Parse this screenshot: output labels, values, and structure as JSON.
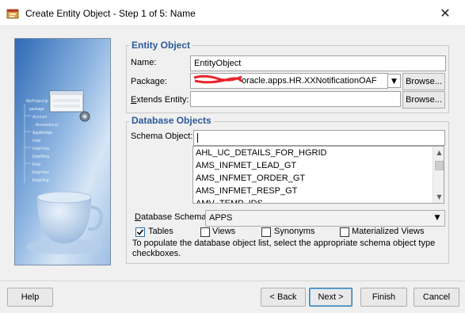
{
  "window": {
    "title": "Create Entity Object - Step 1 of 5: Name",
    "close_glyph": "✕",
    "icon": "entity-wizard-icon"
  },
  "entity_object": {
    "group_title": "Entity Object",
    "name_label": "Name:",
    "name_value": "EntityObject",
    "package_label": "Package:",
    "package_value": "oracle.apps.HR.XXNotificationOAF",
    "package_redacted_prefix_color": "#e8242a",
    "extends_label": "Extends Entity:",
    "extends_value": "",
    "browse_label": "Browse..."
  },
  "database_objects": {
    "group_title": "Database Objects",
    "schema_object_label": "Schema Object:",
    "schema_object_value": "",
    "list_items": [
      "AHL_UC_DETAILS_FOR_HGRID",
      "AMS_INFMET_LEAD_GT",
      "AMS_INFMET_ORDER_GT",
      "AMS_INFMET_RESP_GT",
      "AMV_TEMP_IDS"
    ],
    "database_schema_label": "Database Schema:",
    "database_schema_value": "APPS",
    "checkboxes": [
      {
        "label": "Tables",
        "checked": true
      },
      {
        "label": "Views",
        "checked": false
      },
      {
        "label": "Synonyms",
        "checked": false
      },
      {
        "label": "Materialized Views",
        "checked": false
      }
    ],
    "hint": "To populate the database object list, select the appropriate schema object type checkboxes."
  },
  "footer": {
    "help": "Help",
    "back": "< Back",
    "next": "Next >",
    "finish": "Finish",
    "cancel": "Cancel"
  },
  "colors": {
    "group_title": "#2b5a9a",
    "default_button_border": "#3c7fb1"
  }
}
